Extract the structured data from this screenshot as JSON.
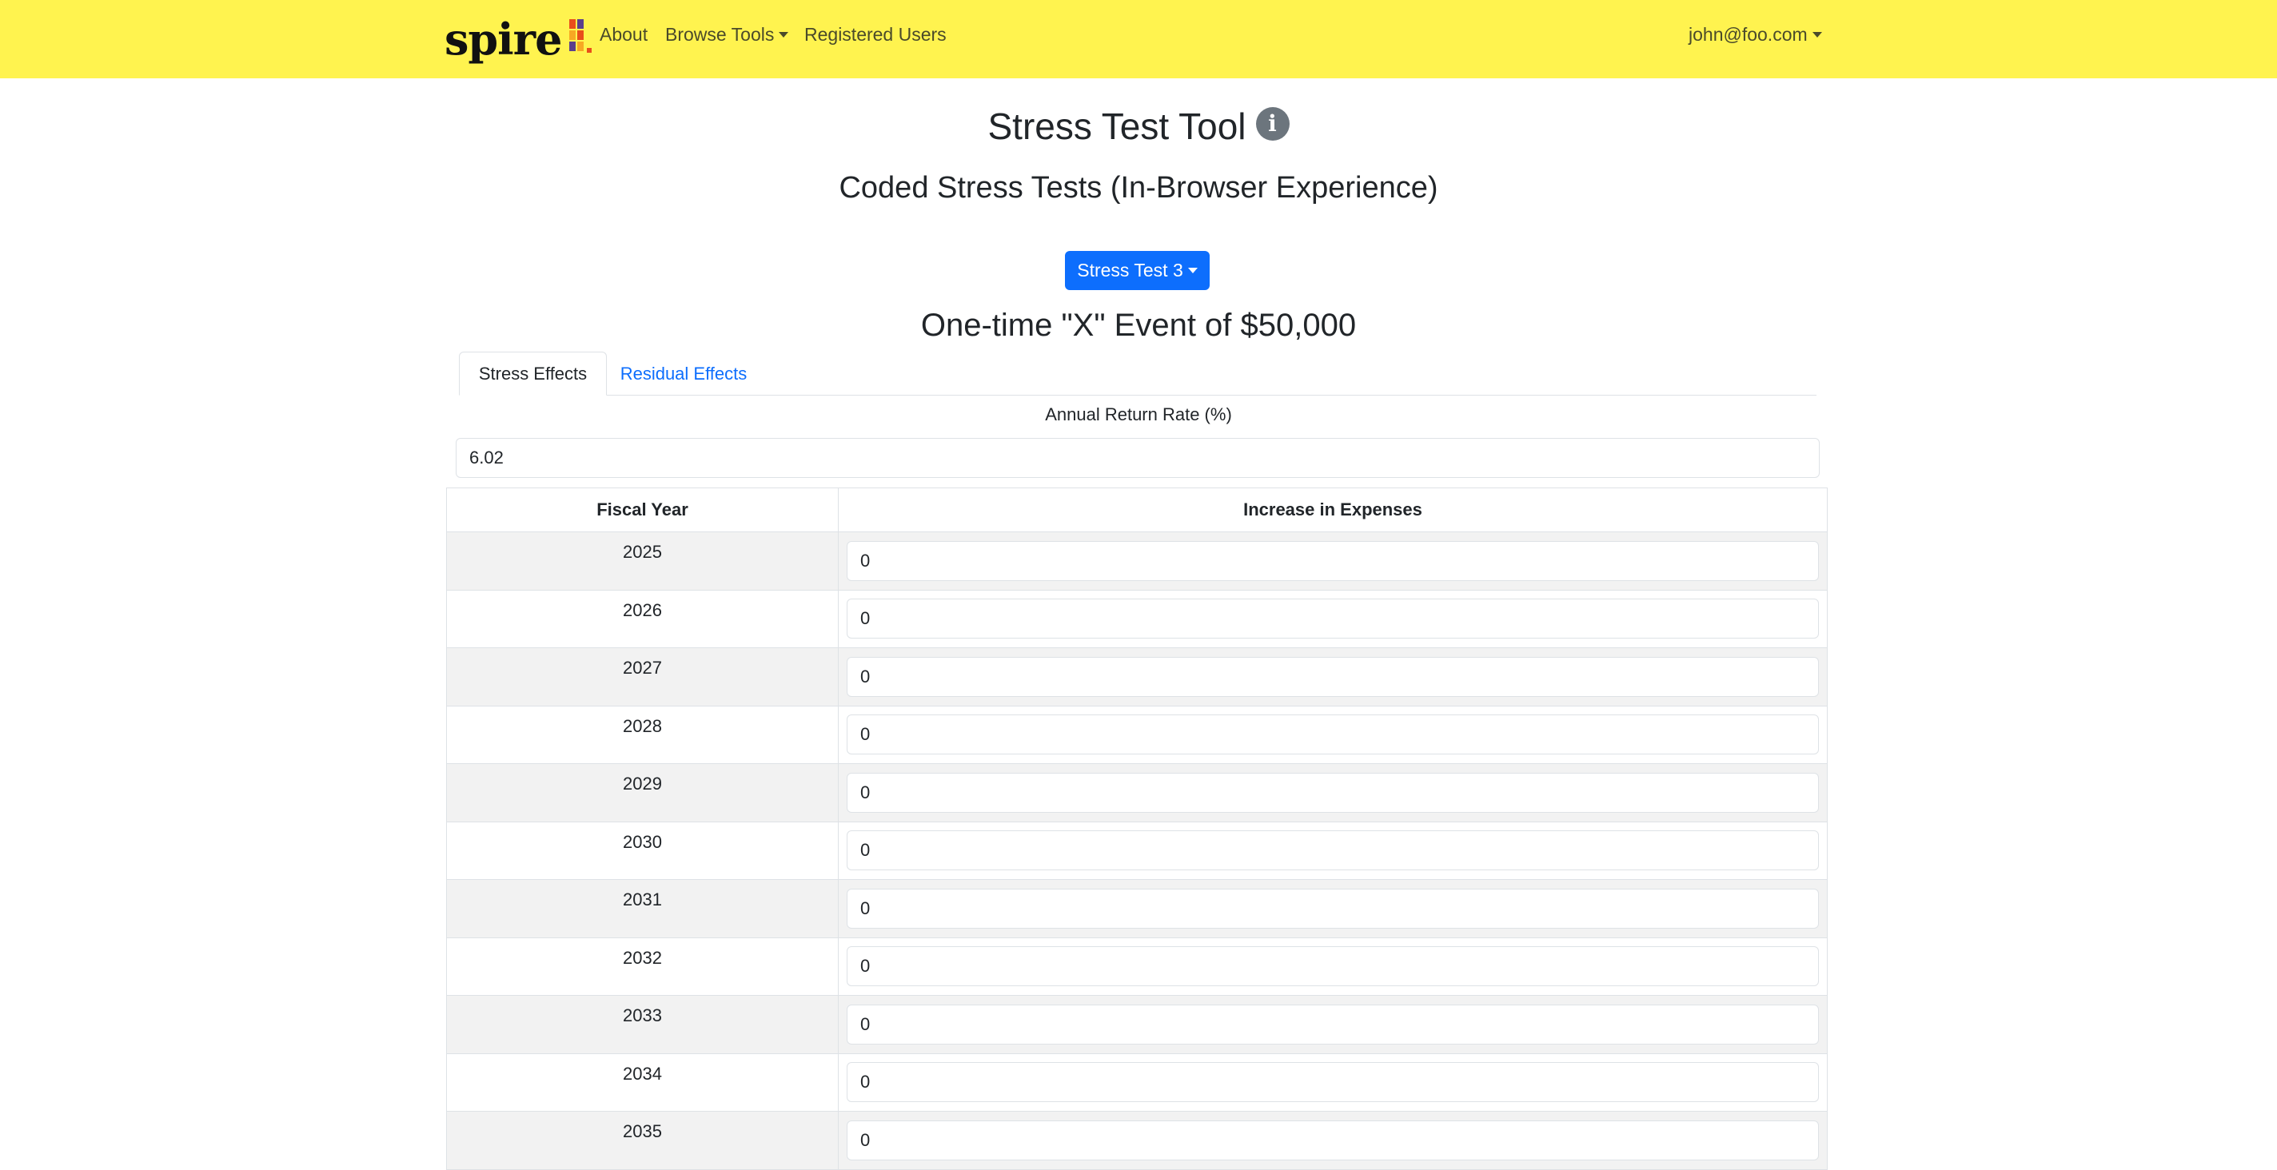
{
  "brand": {
    "name": "spire"
  },
  "nav": {
    "about": "About",
    "browse_tools": "Browse Tools",
    "registered_users": "Registered Users",
    "user": "john@foo.com"
  },
  "page": {
    "title": "Stress Test Tool",
    "subtitle": "Coded Stress Tests (In-Browser Experience)",
    "selected_test": "Stress Test 3",
    "event_title": "One-time \"X\" Event of $50,000"
  },
  "tabs": [
    {
      "label": "Stress Effects",
      "active": true
    },
    {
      "label": "Residual Effects",
      "active": false
    }
  ],
  "rate": {
    "label": "Annual Return Rate (%)",
    "value": "6.02"
  },
  "table": {
    "headers": [
      "Fiscal Year",
      "Increase in Expenses"
    ],
    "rows": [
      {
        "year": "2025",
        "value": "0"
      },
      {
        "year": "2026",
        "value": "0"
      },
      {
        "year": "2027",
        "value": "0"
      },
      {
        "year": "2028",
        "value": "0"
      },
      {
        "year": "2029",
        "value": "0"
      },
      {
        "year": "2030",
        "value": "0"
      },
      {
        "year": "2031",
        "value": "0"
      },
      {
        "year": "2032",
        "value": "0"
      },
      {
        "year": "2033",
        "value": "0"
      },
      {
        "year": "2034",
        "value": "0"
      },
      {
        "year": "2035",
        "value": "0"
      }
    ]
  },
  "colors": {
    "navbar": "#fff34f",
    "primary": "#0d6efd",
    "info_icon": "#6c757d",
    "row_stripe": "#f2f2f2"
  },
  "icons": [
    "spire-logo-icon",
    "info-icon",
    "caret-down-icon"
  ]
}
